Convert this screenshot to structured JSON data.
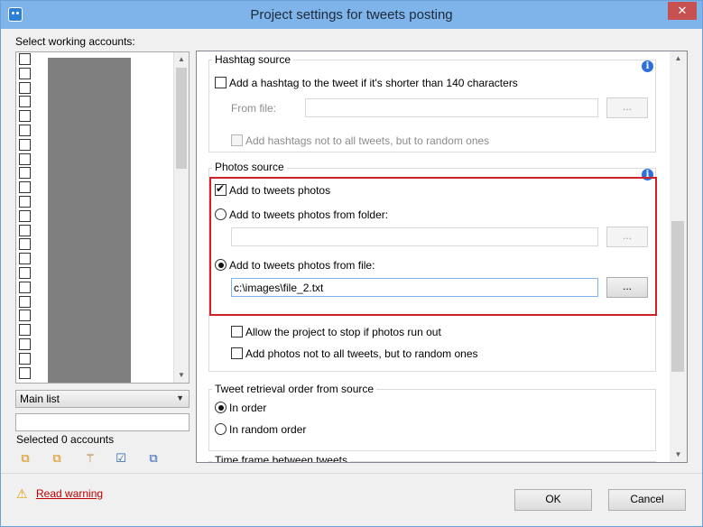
{
  "window": {
    "title": "Project settings for tweets posting"
  },
  "accounts": {
    "label": "Select working accounts:",
    "row_count": 23,
    "list_selected": "Main list",
    "filter_value": "",
    "selected_status": "Selected 0 accounts"
  },
  "hashtag": {
    "group_title": "Hashtag source",
    "add_hashtag_label": "Add a hashtag to the tweet if it's shorter than 140 characters",
    "add_hashtag_checked": false,
    "from_file_label": "From file:",
    "from_file_value": "",
    "browse_label": "...",
    "random_label": "Add hashtags not to all tweets, but to random ones",
    "random_checked": false
  },
  "photos": {
    "group_title": "Photos source",
    "add_photos_label": "Add to tweets photos",
    "add_photos_checked": true,
    "from_folder_label": "Add to tweets photos from folder:",
    "folder_value": "",
    "browse_folder_label": "...",
    "from_file_label": "Add to tweets photos from file:",
    "file_value": "c:\\images\\file_2.txt",
    "browse_file_label": "...",
    "stop_label": "Allow the project to stop if photos run out",
    "stop_checked": false,
    "random_label": "Add photos not to all tweets, but to random ones",
    "random_checked": false
  },
  "retrieval": {
    "group_title": "Tweet retrieval order from source",
    "in_order_label": "In order",
    "random_order_label": "In random order",
    "selected": "In order"
  },
  "timeframe": {
    "group_title": "Time frame between tweets"
  },
  "footer": {
    "warning_link": "Read warning",
    "ok_label": "OK",
    "cancel_label": "Cancel"
  },
  "icons": {
    "app": "app-icon",
    "info": "info-icon",
    "warning": "warning-icon",
    "select_all": "select-all-icon",
    "deselect": "deselect-icon",
    "magic_select": "wand-icon",
    "check_all": "check-all-icon",
    "check_none": "check-none-icon"
  },
  "colors": {
    "titlebar": "#7eb4ea",
    "highlight_border": "#d0202a",
    "warning_link": "#c00000",
    "info_icon": "#2e6fd8"
  }
}
